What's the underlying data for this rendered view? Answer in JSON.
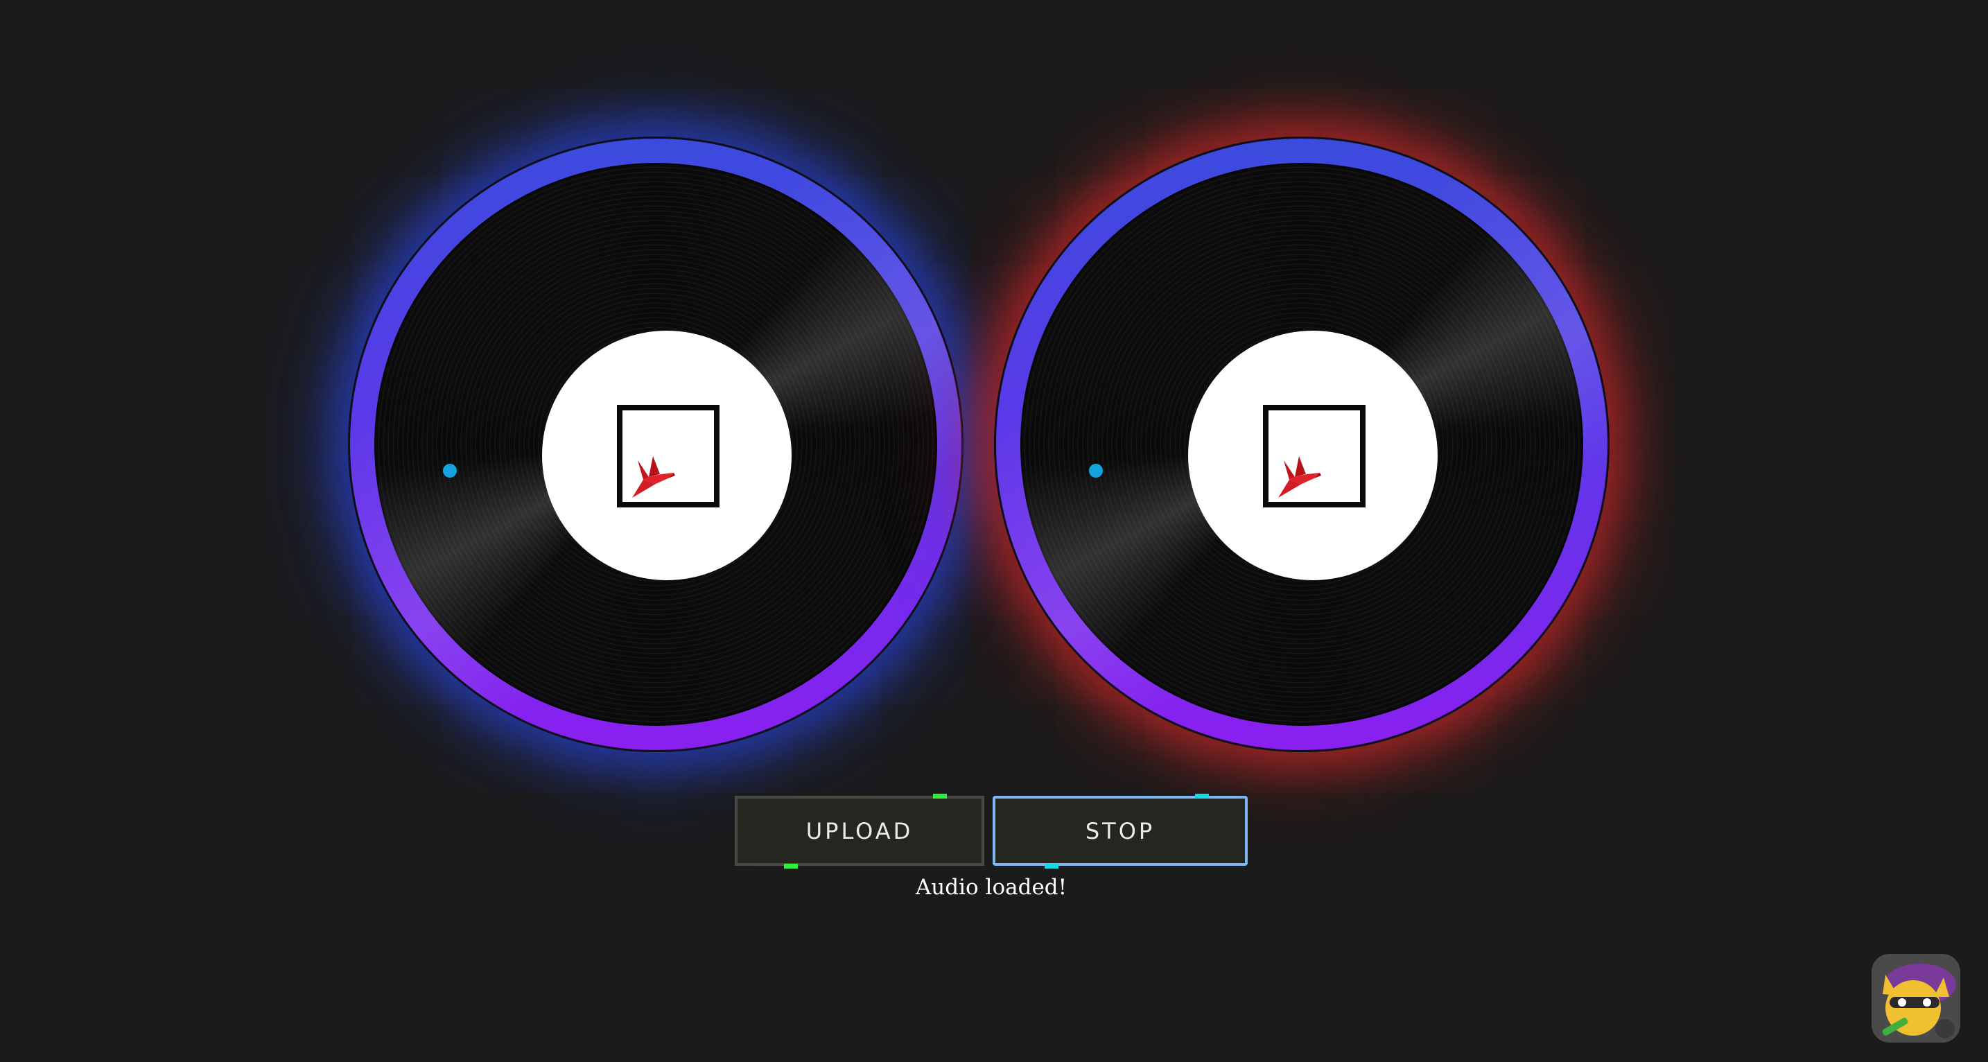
{
  "decks": {
    "left": {
      "glow_color": "#2846dc",
      "label_icon": "bird-logo-icon",
      "marker_color": "#12a3e0"
    },
    "right": {
      "glow_color": "#d72828",
      "label_icon": "bird-logo-icon",
      "marker_color": "#12a3e0"
    }
  },
  "controls": {
    "upload_label": "UPLOAD",
    "stop_label": "STOP",
    "status_text": "Audio loaded!"
  },
  "ring_gradient": [
    "#3b4bde",
    "#8a1ff0"
  ],
  "accent_colors": {
    "green_tick": "#2ff03c",
    "cyan_tick": "#19d8e6",
    "stop_border": "#7eb6f2"
  },
  "avatar": {
    "icon": "avatar-icon"
  }
}
